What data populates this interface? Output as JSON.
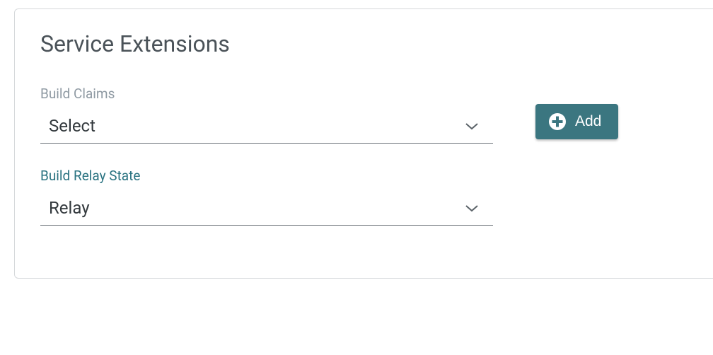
{
  "panel": {
    "title": "Service Extensions"
  },
  "fields": {
    "build_claims": {
      "label": "Build Claims",
      "value": "Select"
    },
    "build_relay_state": {
      "label": "Build Relay State",
      "value": "Relay"
    }
  },
  "actions": {
    "add_label": "Add"
  }
}
